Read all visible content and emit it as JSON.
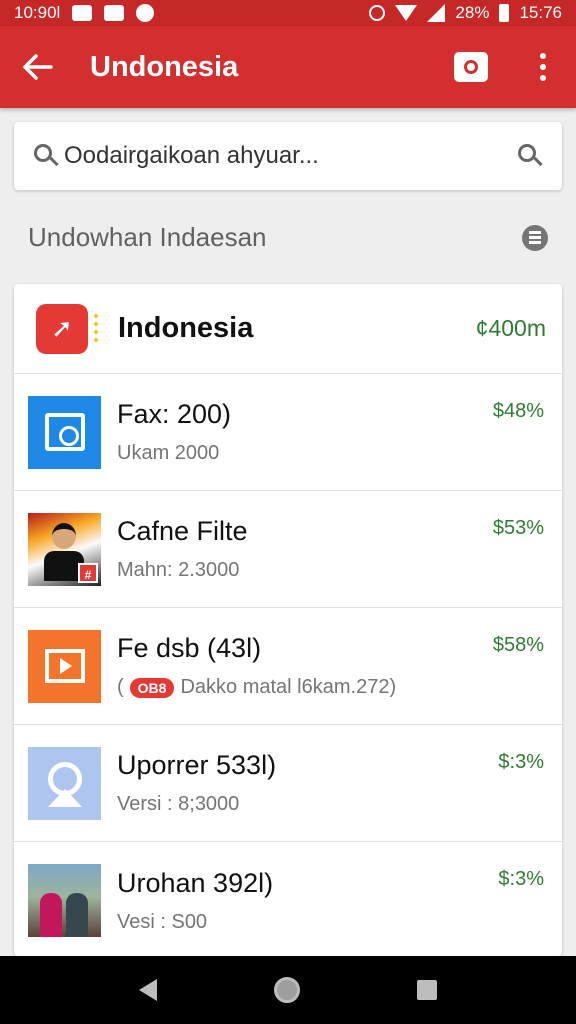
{
  "status_bar": {
    "time_left": "10:90l",
    "battery": "28%",
    "time_right": "15:76"
  },
  "app_bar": {
    "title": "Undonesia",
    "back_icon": "back-arrow-icon",
    "camera_icon": "camera-icon",
    "more_icon": "more-vert-icon"
  },
  "search": {
    "placeholder": "Oodairgaikoan ahyuar..."
  },
  "section": {
    "title": "Undowhan Indaesan"
  },
  "list": {
    "header": {
      "title": "Indonesia",
      "value": "¢400m"
    },
    "items": [
      {
        "title": "Fax: 200)",
        "subtitle": "Ukam 2000",
        "percent": "$48%",
        "badge": ""
      },
      {
        "title": "Cafne Filte",
        "subtitle": "Mahn: 2.3000",
        "percent": "$53%",
        "badge": ""
      },
      {
        "title": "Fe dsb (43l)",
        "subtitle": "Dakko matal l6kam.272)",
        "percent": "$58%",
        "badge": "OB8",
        "sub_prefix": "("
      },
      {
        "title": "Uporrer 533l)",
        "subtitle": "Versi : 8;3000",
        "percent": "$:3%",
        "badge": ""
      },
      {
        "title": "Urohan 392l)",
        "subtitle": "Vesi : S00",
        "percent": "$:3%",
        "badge": ""
      }
    ]
  },
  "colors": {
    "app_bar": "#d32f2f",
    "status_bar": "#c62828",
    "positive": "#2e7d32"
  }
}
